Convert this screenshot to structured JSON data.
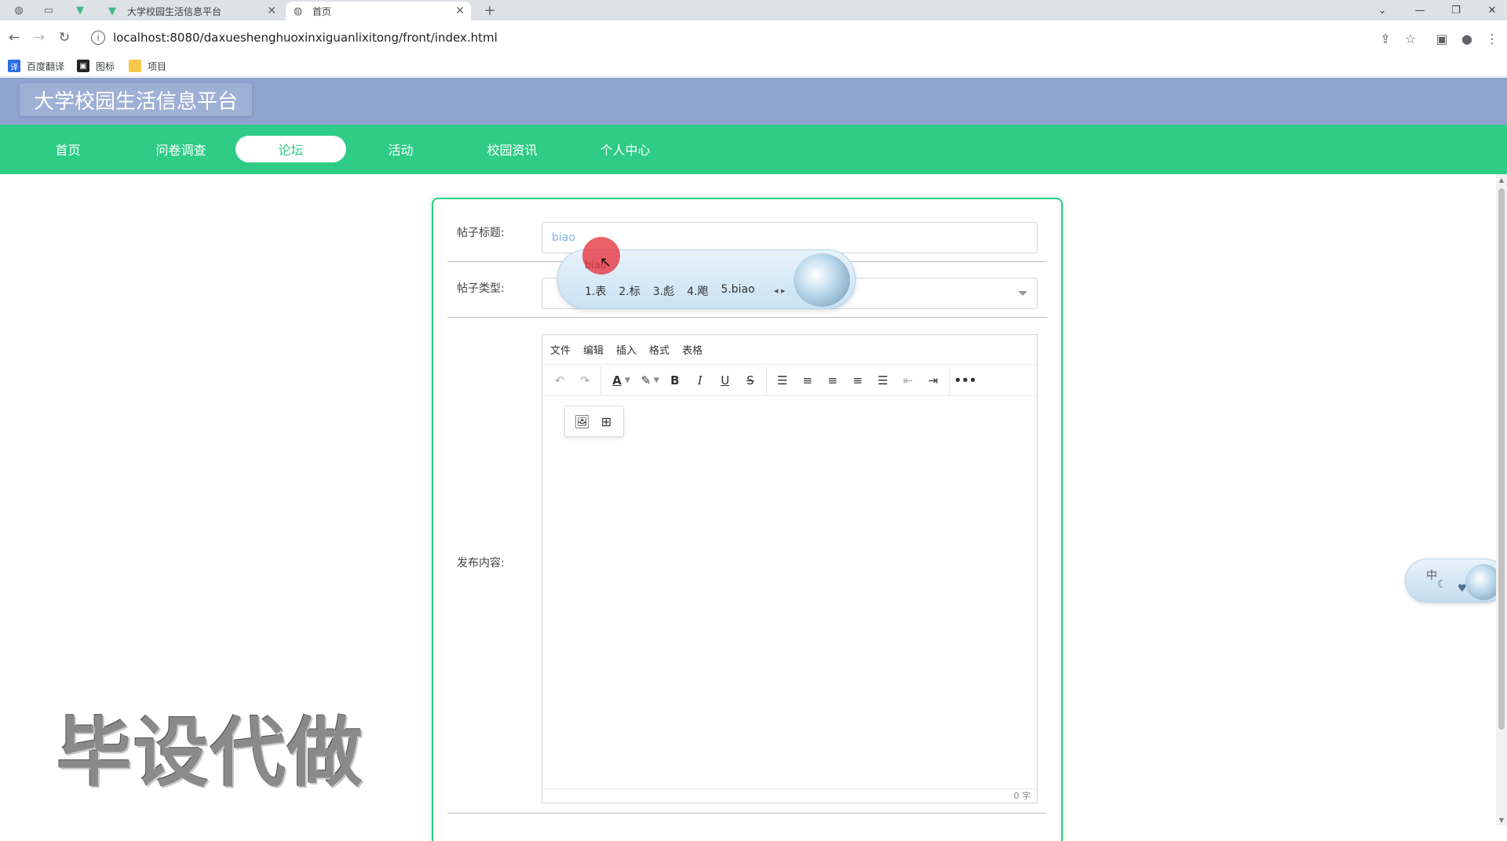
{
  "browser": {
    "tabs": [
      {
        "title": "大学校园生活信息平台",
        "icon": "vue-logo-icon"
      },
      {
        "title": "首页",
        "icon": "globe-icon"
      }
    ],
    "url": "localhost:8080/daxueshenghuoxinxiguanlixitong/front/index.html",
    "bookmarks": [
      "百度翻译",
      "图标",
      "项目"
    ]
  },
  "site": {
    "title": "大学校园生活信息平台",
    "nav": [
      "首页",
      "问卷调查",
      "论坛",
      "活动",
      "校园资讯",
      "个人中心"
    ],
    "active_nav": "论坛"
  },
  "form": {
    "title_label": "帖子标题:",
    "title_value": "biao",
    "type_label": "帖子类型:",
    "type_value": "",
    "content_label": "发布内容:"
  },
  "editor": {
    "menu": [
      "文件",
      "编辑",
      "插入",
      "格式",
      "表格"
    ],
    "word_count": "0 字"
  },
  "ime": {
    "composition": "biao",
    "candidates": [
      "1.表",
      "2.标",
      "3.彪",
      "4.飑",
      "5.biao"
    ],
    "mode_label": "中"
  },
  "watermark": "毕设代做",
  "colors": {
    "header_bg": "#8fa3cf",
    "nav_bg": "#2ecc85",
    "accent": "#2ecc85"
  }
}
